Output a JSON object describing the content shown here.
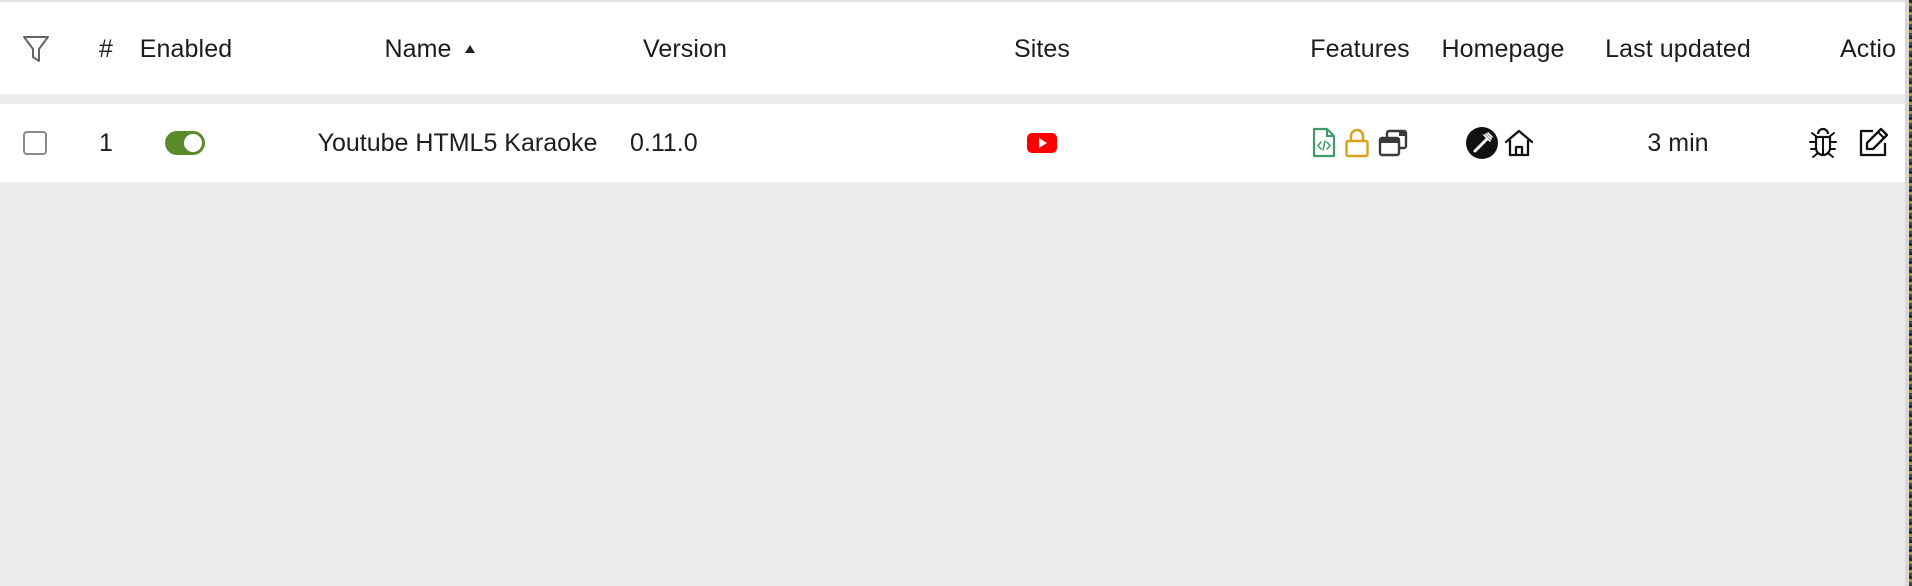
{
  "table": {
    "headers": {
      "number": "#",
      "enabled": "Enabled",
      "name": "Name",
      "version": "Version",
      "sites": "Sites",
      "features": "Features",
      "homepage": "Homepage",
      "last_updated": "Last updated",
      "actions": "Actio"
    },
    "sort": {
      "column": "Name",
      "direction": "ascending"
    },
    "rows": [
      {
        "number": "1",
        "enabled": true,
        "name": "Youtube HTML5 Karaoke",
        "version": "0.11.0",
        "site_icon": "youtube-icon",
        "feature_icons": [
          "userscript-file-icon",
          "lock-icon",
          "windows-icon"
        ],
        "homepage_icons": [
          "greasy-fork-icon",
          "home-icon"
        ],
        "last_updated": "3 min",
        "action_icons": [
          "bug-icon",
          "edit-icon"
        ]
      }
    ]
  },
  "colors": {
    "toggle_on": "#5b8a2c",
    "youtube_red": "#ff0000",
    "feature_green": "#3f9b6a",
    "feature_gold": "#d6a21d",
    "row_background": "#ffffff",
    "page_background": "#ececec"
  }
}
